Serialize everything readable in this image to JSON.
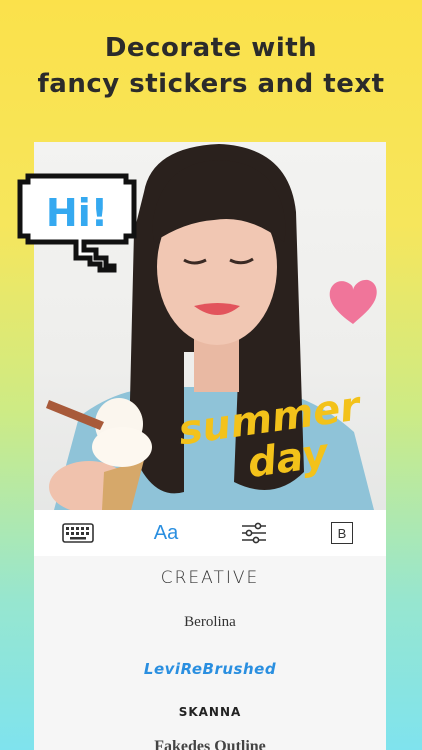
{
  "headline": {
    "line1": "Decorate with",
    "line2": "fancy stickers and text"
  },
  "stickers": {
    "speech_bubble_text": "Hi!",
    "brush_line1": "summer",
    "brush_line2": "day",
    "heart_color": "#f06a92"
  },
  "toolbar": {
    "keyboard_icon": "keyboard-icon",
    "font_tab_label": "Aa",
    "adjust_icon": "sliders-icon",
    "bold_label": "B"
  },
  "fonts": [
    {
      "label": "CREATIVE"
    },
    {
      "label": "Berolina"
    },
    {
      "label": "LeviReBrushed"
    },
    {
      "label": "SKANNA"
    },
    {
      "label": "Fakedes Outline"
    }
  ],
  "colors": {
    "accent": "#2a8fe0",
    "sticker_brush": "#f3c21a",
    "background_top": "#fbe14b",
    "background_bottom": "#7fe3ee"
  }
}
